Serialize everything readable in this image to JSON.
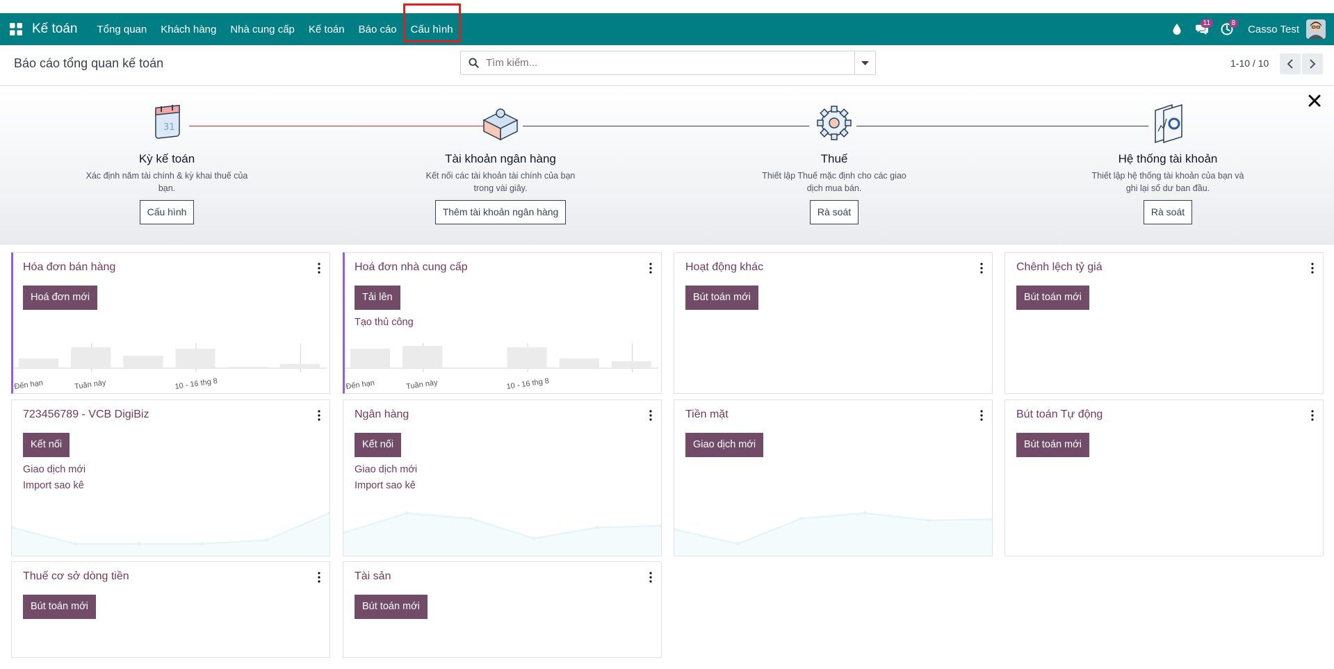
{
  "navbar": {
    "brand": "Kế toán",
    "menu": [
      "Tổng quan",
      "Khách hàng",
      "Nhà cung cấp",
      "Kế toán",
      "Báo cáo",
      "Cấu hình"
    ],
    "messages_badge": "11",
    "activities_badge": "8",
    "user": "Casso Test"
  },
  "control_panel": {
    "title": "Báo cáo tổng quan kế toán",
    "search_placeholder": "Tìm kiếm...",
    "pager": "1-10 / 10"
  },
  "onboarding": {
    "steps": [
      {
        "title": "Kỳ kế toán",
        "desc1": "Xác định năm tài chính & kỳ khai thuế của",
        "desc2": "bạn.",
        "button": "Cấu hình"
      },
      {
        "title": "Tài khoản ngân hàng",
        "desc1": "Kết nối các tài khoản tài chính của bạn",
        "desc2": "trong vài giây.",
        "button": "Thêm tài khoản ngân hàng"
      },
      {
        "title": "Thuế",
        "desc1": "Thiết lập Thuế mặc định cho các giao",
        "desc2": "dịch mua bán.",
        "button": "Rà soát"
      },
      {
        "title": "Hệ thống tài khoản",
        "desc1": "Thiết lập hệ thống tài khoản của bạn và",
        "desc2": "ghi lại số dư ban đầu.",
        "button": "Rà soát"
      }
    ]
  },
  "journals": [
    {
      "title": "Hóa đơn bán hàng",
      "button": "Hoá đơn mới",
      "links": [],
      "graph": "bar",
      "bars": [
        0.35,
        0.75,
        0.45,
        0.7,
        0.05,
        0.15
      ],
      "labels": [
        "Đến hạn",
        "Tuần này",
        "10 - 16 thg 8"
      ]
    },
    {
      "title": "Hoá đơn nhà cung cấp",
      "button": "Tải lên",
      "links": [
        "Tạo thủ công"
      ],
      "graph": "bar",
      "bars": [
        0.7,
        0.8,
        0.0,
        0.75,
        0.35,
        0.25
      ],
      "labels": [
        "Đến hạn",
        "Tuần này",
        "10 - 16 thg 8"
      ]
    },
    {
      "title": "Hoạt động khác",
      "button": "Bút toán mới",
      "links": [],
      "graph": "none"
    },
    {
      "title": "Chênh lệch tỷ giá",
      "button": "Bút toán mới",
      "links": [],
      "graph": "none"
    },
    {
      "title": "723456789 - VCB DigiBiz",
      "button": "Kết nối",
      "links": [
        "Giao dịch mới",
        "Import sao kê"
      ],
      "graph": "line",
      "points": [
        0.55,
        0.1,
        0.1,
        0.1,
        0.2,
        0.95
      ]
    },
    {
      "title": "Ngân hàng",
      "button": "Kết nối",
      "links": [
        "Giao dịch mới",
        "Import sao kê"
      ],
      "graph": "line",
      "points": [
        0.4,
        0.95,
        0.8,
        0.25,
        0.55,
        0.6
      ]
    },
    {
      "title": "Tiền mặt",
      "button": "Giao dịch mới",
      "links": [],
      "graph": "line",
      "points": [
        0.5,
        0.1,
        0.8,
        0.95,
        0.75,
        0.78
      ]
    },
    {
      "title": "Bút toán Tự động",
      "button": "Bút toán mới",
      "links": [],
      "graph": "none"
    },
    {
      "title": "Thuế cơ sở dòng tiền",
      "button": "Bút toán mới",
      "links": [],
      "graph": "none"
    },
    {
      "title": "Tài sản",
      "button": "Bút toán mới",
      "links": [],
      "graph": "none"
    }
  ],
  "colors": {
    "navbar": "#017e84",
    "primary": "#714b67",
    "accent": "#8b5cf6"
  }
}
